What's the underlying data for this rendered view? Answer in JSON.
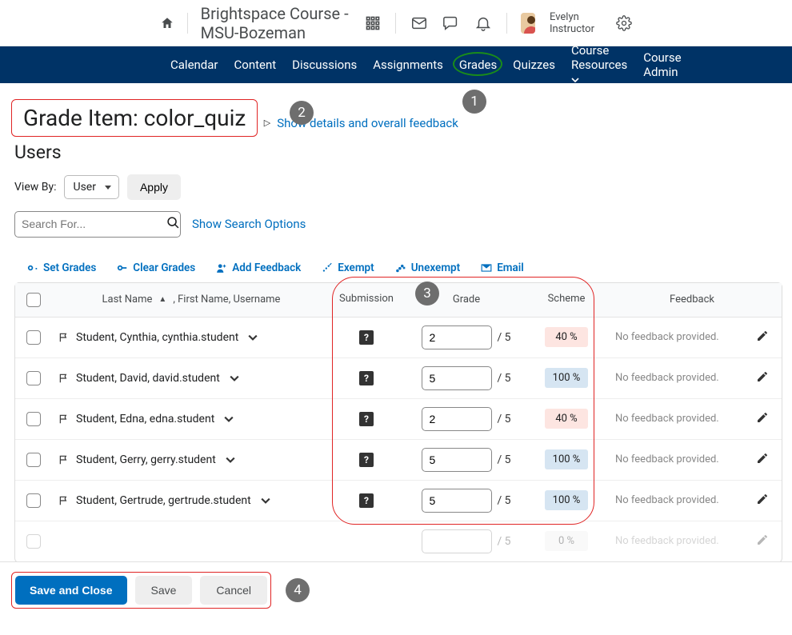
{
  "topbar": {
    "course_title": "Brightspace Course - MSU-Bozeman",
    "user_name": "Evelyn Instructor"
  },
  "nav": {
    "items": [
      "Calendar",
      "Content",
      "Discussions",
      "Assignments",
      "Grades",
      "Quizzes",
      "Course Resources",
      "Course Admin"
    ]
  },
  "page": {
    "title": "Grade Item: color_quiz",
    "details_link": "Show details and overall feedback",
    "users_heading": "Users",
    "view_by_label": "View By:",
    "view_by_value": "User",
    "apply_label": "Apply",
    "search_placeholder": "Search For...",
    "search_options": "Show Search Options"
  },
  "actions": {
    "set_grades": "Set Grades",
    "clear_grades": "Clear Grades",
    "add_feedback": "Add Feedback",
    "exempt": "Exempt",
    "unexempt": "Unexempt",
    "email": "Email"
  },
  "table": {
    "head": {
      "name": "Last Name",
      "name_suffix": ", First Name, Username",
      "submission": "Submission",
      "grade": "Grade",
      "scheme": "Scheme",
      "feedback": "Feedback"
    },
    "denom": "/ 5",
    "rows": [
      {
        "name": "Student, Cynthia, cynthia.student",
        "grade": "2",
        "scheme": "40 %",
        "scheme_class": "scheme-low",
        "feedback": "No feedback provided."
      },
      {
        "name": "Student, David, david.student",
        "grade": "5",
        "scheme": "100 %",
        "scheme_class": "scheme-high",
        "feedback": "No feedback provided."
      },
      {
        "name": "Student, Edna, edna.student",
        "grade": "2",
        "scheme": "40 %",
        "scheme_class": "scheme-low",
        "feedback": "No feedback provided."
      },
      {
        "name": "Student, Gerry, gerry.student",
        "grade": "5",
        "scheme": "100 %",
        "scheme_class": "scheme-high",
        "feedback": "No feedback provided."
      },
      {
        "name": "Student, Gertrude, gertrude.student",
        "grade": "5",
        "scheme": "100 %",
        "scheme_class": "scheme-high",
        "feedback": "No feedback provided."
      }
    ],
    "faded": {
      "denom": "/ 5",
      "scheme": "0 %",
      "feedback": "No feedback provided."
    }
  },
  "footer": {
    "save_close": "Save and Close",
    "save": "Save",
    "cancel": "Cancel"
  },
  "callouts": {
    "c1": "1",
    "c2": "2",
    "c3": "3",
    "c4": "4"
  }
}
